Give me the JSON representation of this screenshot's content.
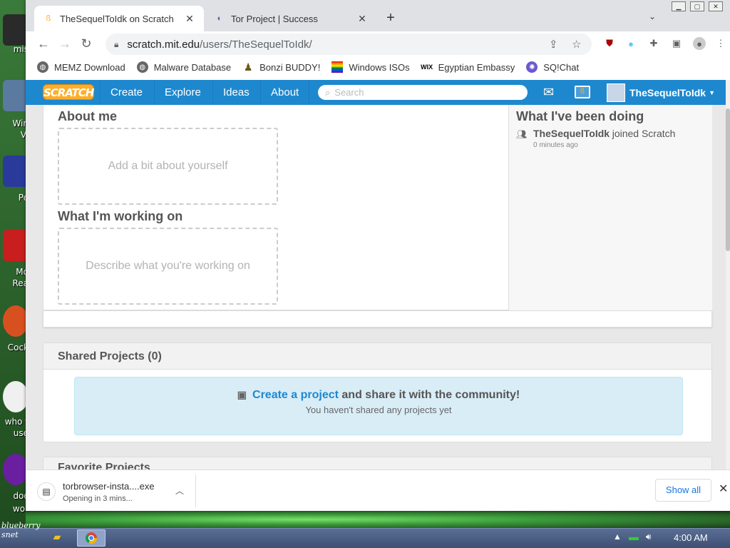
{
  "desktop": {
    "icon_labels": [
      "mis",
      "Win",
      "Vi",
      "Pe",
      "Mo",
      "Rea",
      "Cock",
      "who t",
      "use",
      "doc",
      "wor"
    ],
    "watermark": "blueberry\nsnet"
  },
  "browser": {
    "tabs": [
      {
        "title": "TheSequelToIdk on Scratch",
        "active": true
      },
      {
        "title": "Tor Project | Success",
        "active": false
      }
    ],
    "new_tab": "+",
    "url_host": "scratch.mit.edu",
    "url_path": "/users/TheSequelToIdk/",
    "extension_badge": "2",
    "bookmarks": [
      {
        "label": "MEMZ Download",
        "icon": "globe-icon"
      },
      {
        "label": "Malware Database",
        "icon": "globe-icon"
      },
      {
        "label": "Bonzi BUDDY!",
        "icon": "bonzi-icon"
      },
      {
        "label": "Windows ISOs",
        "icon": "rainbow-icon"
      },
      {
        "label": "Egyptian Embassy",
        "icon": "wix-icon"
      },
      {
        "label": "SQ!Chat",
        "icon": "chat-icon"
      }
    ]
  },
  "scratch": {
    "logo": "SCRATCH",
    "nav": [
      "Create",
      "Explore",
      "Ideas",
      "About"
    ],
    "search_placeholder": "Search",
    "username": "TheSequelToIdk",
    "about_title": "About me",
    "about_placeholder": "Add a bit about yourself",
    "working_title": "What I'm working on",
    "working_placeholder": "Describe what you're working on",
    "activity_title": "What I've been doing",
    "activity": {
      "user": "TheSequelToIdk",
      "action": "joined Scratch",
      "time": "0 minutes ago"
    },
    "shared_title": "Shared Projects (0)",
    "shared_link": "Create a project",
    "shared_rest": "and share it with the community!",
    "shared_sub": "You haven't shared any projects yet",
    "favorites_title": "Favorite Projects"
  },
  "downloads": {
    "filename": "torbrowser-insta....exe",
    "status": "Opening in 3 mins...",
    "show_all": "Show all"
  },
  "taskbar": {
    "clock": "4:00 AM"
  },
  "colors": {
    "scratch_blue": "#1e88cf",
    "scratch_orange": "#ffae2a",
    "info_bg": "#d9edf7"
  }
}
